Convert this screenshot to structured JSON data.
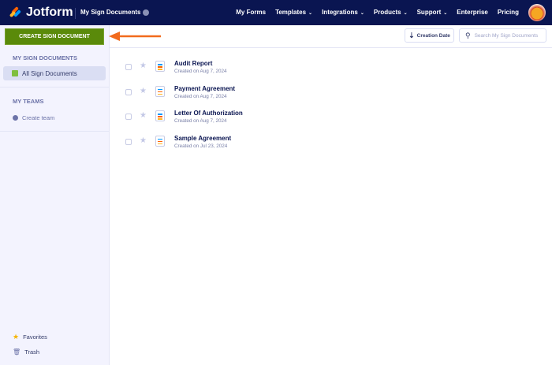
{
  "header": {
    "logo": "Jotform",
    "breadcrumb": "My Sign Documents",
    "nav": [
      {
        "label": "My Forms",
        "dropdown": false
      },
      {
        "label": "Templates",
        "dropdown": true
      },
      {
        "label": "Integrations",
        "dropdown": true
      },
      {
        "label": "Products",
        "dropdown": true
      },
      {
        "label": "Support",
        "dropdown": true
      },
      {
        "label": "Enterprise",
        "dropdown": false
      },
      {
        "label": "Pricing",
        "dropdown": false
      }
    ]
  },
  "create_button": "CREATE SIGN DOCUMENT",
  "sidebar": {
    "section1": "MY SIGN DOCUMENTS",
    "all_docs": "All Sign Documents",
    "section2": "MY TEAMS",
    "create_team": "Create team",
    "favorites": "Favorites",
    "trash": "Trash"
  },
  "toolbar": {
    "sort": "Creation Date",
    "search_placeholder": "Search My Sign Documents"
  },
  "documents": [
    {
      "title": "Audit Report",
      "created": "Created on Aug 7, 2024"
    },
    {
      "title": "Payment Agreement",
      "created": "Created on Aug 7, 2024"
    },
    {
      "title": "Letter Of Authorization",
      "created": "Created on Aug 7, 2024"
    },
    {
      "title": "Sample Agreement",
      "created": "Created on Jul 23, 2024"
    }
  ],
  "colors": {
    "header": "#0a1551",
    "create": "#5a8a0a",
    "arrow": "#f26b1d"
  }
}
